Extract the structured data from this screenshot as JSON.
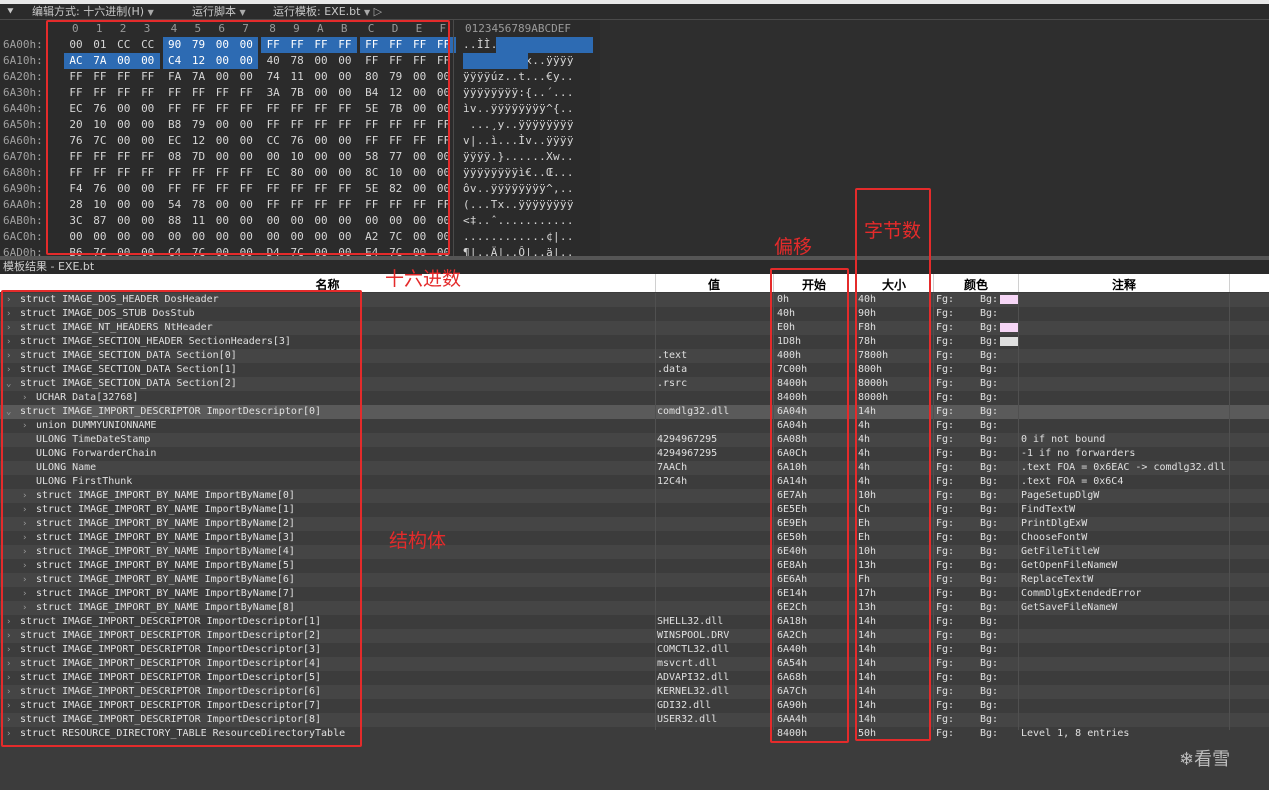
{
  "toolbar": {
    "edit_mode": "编辑方式: 十六进制(H)",
    "run_script": "运行脚本",
    "run_template": "运行模板: EXE.bt"
  },
  "hex": {
    "columns": [
      "0",
      "1",
      "2",
      "3",
      "4",
      "5",
      "6",
      "7",
      "8",
      "9",
      "A",
      "B",
      "C",
      "D",
      "E",
      "F"
    ],
    "ascii_header": "0123456789ABCDEF",
    "rows": [
      {
        "off": "6A00h:",
        "bytes": [
          "00",
          "01",
          "CC",
          "CC",
          "90",
          "79",
          "00",
          "00",
          "FF",
          "FF",
          "FF",
          "FF",
          "FF",
          "FF",
          "FF",
          "FF"
        ],
        "ascii": "..ÌÌ.y..ÿÿÿÿÿÿÿÿ"
      },
      {
        "off": "6A10h:",
        "bytes": [
          "AC",
          "7A",
          "00",
          "00",
          "C4",
          "12",
          "00",
          "00",
          "40",
          "78",
          "00",
          "00",
          "FF",
          "FF",
          "FF",
          "FF"
        ],
        "ascii": "¬z..Ä...@x..ÿÿÿÿ"
      },
      {
        "off": "6A20h:",
        "bytes": [
          "FF",
          "FF",
          "FF",
          "FF",
          "FA",
          "7A",
          "00",
          "00",
          "74",
          "11",
          "00",
          "00",
          "80",
          "79",
          "00",
          "00"
        ],
        "ascii": "ÿÿÿÿúz..t...€y.."
      },
      {
        "off": "6A30h:",
        "bytes": [
          "FF",
          "FF",
          "FF",
          "FF",
          "FF",
          "FF",
          "FF",
          "FF",
          "3A",
          "7B",
          "00",
          "00",
          "B4",
          "12",
          "00",
          "00"
        ],
        "ascii": "ÿÿÿÿÿÿÿÿ:{..´..."
      },
      {
        "off": "6A40h:",
        "bytes": [
          "EC",
          "76",
          "00",
          "00",
          "FF",
          "FF",
          "FF",
          "FF",
          "FF",
          "FF",
          "FF",
          "FF",
          "5E",
          "7B",
          "00",
          "00"
        ],
        "ascii": "ìv..ÿÿÿÿÿÿÿÿ^{.."
      },
      {
        "off": "6A50h:",
        "bytes": [
          "20",
          "10",
          "00",
          "00",
          "B8",
          "79",
          "00",
          "00",
          "FF",
          "FF",
          "FF",
          "FF",
          "FF",
          "FF",
          "FF",
          "FF"
        ],
        "ascii": " ...¸y..ÿÿÿÿÿÿÿÿ"
      },
      {
        "off": "6A60h:",
        "bytes": [
          "76",
          "7C",
          "00",
          "00",
          "EC",
          "12",
          "00",
          "00",
          "CC",
          "76",
          "00",
          "00",
          "FF",
          "FF",
          "FF",
          "FF"
        ],
        "ascii": "v|..ì...Ìv..ÿÿÿÿ"
      },
      {
        "off": "6A70h:",
        "bytes": [
          "FF",
          "FF",
          "FF",
          "FF",
          "08",
          "7D",
          "00",
          "00",
          "00",
          "10",
          "00",
          "00",
          "58",
          "77",
          "00",
          "00"
        ],
        "ascii": "ÿÿÿÿ.}......Xw.."
      },
      {
        "off": "6A80h:",
        "bytes": [
          "FF",
          "FF",
          "FF",
          "FF",
          "FF",
          "FF",
          "FF",
          "FF",
          "EC",
          "80",
          "00",
          "00",
          "8C",
          "10",
          "00",
          "00"
        ],
        "ascii": "ÿÿÿÿÿÿÿÿì€..Œ..."
      },
      {
        "off": "6A90h:",
        "bytes": [
          "F4",
          "76",
          "00",
          "00",
          "FF",
          "FF",
          "FF",
          "FF",
          "FF",
          "FF",
          "FF",
          "FF",
          "5E",
          "82",
          "00",
          "00"
        ],
        "ascii": "ôv..ÿÿÿÿÿÿÿÿ^‚.."
      },
      {
        "off": "6AA0h:",
        "bytes": [
          "28",
          "10",
          "00",
          "00",
          "54",
          "78",
          "00",
          "00",
          "FF",
          "FF",
          "FF",
          "FF",
          "FF",
          "FF",
          "FF",
          "FF"
        ],
        "ascii": "(...Tx..ÿÿÿÿÿÿÿÿ"
      },
      {
        "off": "6AB0h:",
        "bytes": [
          "3C",
          "87",
          "00",
          "00",
          "88",
          "11",
          "00",
          "00",
          "00",
          "00",
          "00",
          "00",
          "00",
          "00",
          "00",
          "00"
        ],
        "ascii": "<‡..ˆ..........."
      },
      {
        "off": "6AC0h:",
        "bytes": [
          "00",
          "00",
          "00",
          "00",
          "00",
          "00",
          "00",
          "00",
          "00",
          "00",
          "00",
          "00",
          "A2",
          "7C",
          "00",
          "00"
        ],
        "ascii": "............¢|.."
      },
      {
        "off": "6AD0h:",
        "bytes": [
          "B6",
          "7C",
          "00",
          "00",
          "C4",
          "7C",
          "00",
          "00",
          "D4",
          "7C",
          "00",
          "00",
          "E4",
          "7C",
          "00",
          "00"
        ],
        "ascii": "¶|..Ä|..Ô|..ä|.."
      }
    ]
  },
  "template_header": "模板结果 - EXE.bt",
  "table": {
    "headers": {
      "name": "名称",
      "value": "值",
      "start": "开始",
      "size": "大小",
      "color": "颜色",
      "note": "注释"
    },
    "rows": [
      {
        "name": "struct IMAGE_DOS_HEADER DosHeader",
        "value": "",
        "start": "0h",
        "size": "40h",
        "note": "",
        "exp": "›",
        "indent": 0,
        "swatch": "#f6d6f6"
      },
      {
        "name": "struct IMAGE_DOS_STUB DosStub",
        "value": "",
        "start": "40h",
        "size": "90h",
        "note": "",
        "exp": "›",
        "indent": 0,
        "swatch": ""
      },
      {
        "name": "struct IMAGE_NT_HEADERS NtHeader",
        "value": "",
        "start": "E0h",
        "size": "F8h",
        "note": "",
        "exp": "›",
        "indent": 0,
        "swatch": "#f6d6f6"
      },
      {
        "name": "struct IMAGE_SECTION_HEADER SectionHeaders[3]",
        "value": "",
        "start": "1D8h",
        "size": "78h",
        "note": "",
        "exp": "›",
        "indent": 0,
        "swatch": "#e0e0e0"
      },
      {
        "name": "struct IMAGE_SECTION_DATA Section[0]",
        "value": ".text",
        "start": "400h",
        "size": "7800h",
        "note": "",
        "exp": "›",
        "indent": 0,
        "swatch": ""
      },
      {
        "name": "struct IMAGE_SECTION_DATA Section[1]",
        "value": ".data",
        "start": "7C00h",
        "size": "800h",
        "note": "",
        "exp": "›",
        "indent": 0,
        "swatch": ""
      },
      {
        "name": "struct IMAGE_SECTION_DATA Section[2]",
        "value": ".rsrc",
        "start": "8400h",
        "size": "8000h",
        "note": "",
        "exp": "⌄",
        "indent": 0,
        "swatch": ""
      },
      {
        "name": "UCHAR Data[32768]",
        "value": "",
        "start": "8400h",
        "size": "8000h",
        "note": "",
        "exp": "›",
        "indent": 1,
        "swatch": ""
      },
      {
        "name": "struct IMAGE_IMPORT_DESCRIPTOR ImportDescriptor[0]",
        "value": "comdlg32.dll",
        "start": "6A04h",
        "size": "14h",
        "note": "",
        "exp": "⌄",
        "indent": 0,
        "swatch": "",
        "hl": true
      },
      {
        "name": "union DUMMYUNIONNAME",
        "value": "",
        "start": "6A04h",
        "size": "4h",
        "note": "",
        "exp": "›",
        "indent": 1,
        "swatch": ""
      },
      {
        "name": "ULONG TimeDateStamp",
        "value": "4294967295",
        "start": "6A08h",
        "size": "4h",
        "note": "0 if not bound",
        "exp": "",
        "indent": 1,
        "swatch": ""
      },
      {
        "name": "ULONG ForwarderChain",
        "value": "4294967295",
        "start": "6A0Ch",
        "size": "4h",
        "note": "-1 if no forwarders",
        "exp": "",
        "indent": 1,
        "swatch": ""
      },
      {
        "name": "ULONG Name",
        "value": "7AACh",
        "start": "6A10h",
        "size": "4h",
        "note": ".text FOA = 0x6EAC -> comdlg32.dll",
        "exp": "",
        "indent": 1,
        "swatch": ""
      },
      {
        "name": "ULONG FirstThunk",
        "value": "12C4h",
        "start": "6A14h",
        "size": "4h",
        "note": ".text FOA = 0x6C4",
        "exp": "",
        "indent": 1,
        "swatch": ""
      },
      {
        "name": "struct IMAGE_IMPORT_BY_NAME ImportByName[0]",
        "value": "",
        "start": "6E7Ah",
        "size": "10h",
        "note": "PageSetupDlgW",
        "exp": "›",
        "indent": 1,
        "swatch": ""
      },
      {
        "name": "struct IMAGE_IMPORT_BY_NAME ImportByName[1]",
        "value": "",
        "start": "6E5Eh",
        "size": "Ch",
        "note": "FindTextW",
        "exp": "›",
        "indent": 1,
        "swatch": ""
      },
      {
        "name": "struct IMAGE_IMPORT_BY_NAME ImportByName[2]",
        "value": "",
        "start": "6E9Eh",
        "size": "Eh",
        "note": "PrintDlgExW",
        "exp": "›",
        "indent": 1,
        "swatch": ""
      },
      {
        "name": "struct IMAGE_IMPORT_BY_NAME ImportByName[3]",
        "value": "",
        "start": "6E50h",
        "size": "Eh",
        "note": "ChooseFontW",
        "exp": "›",
        "indent": 1,
        "swatch": ""
      },
      {
        "name": "struct IMAGE_IMPORT_BY_NAME ImportByName[4]",
        "value": "",
        "start": "6E40h",
        "size": "10h",
        "note": "GetFileTitleW",
        "exp": "›",
        "indent": 1,
        "swatch": ""
      },
      {
        "name": "struct IMAGE_IMPORT_BY_NAME ImportByName[5]",
        "value": "",
        "start": "6E8Ah",
        "size": "13h",
        "note": "GetOpenFileNameW",
        "exp": "›",
        "indent": 1,
        "swatch": ""
      },
      {
        "name": "struct IMAGE_IMPORT_BY_NAME ImportByName[6]",
        "value": "",
        "start": "6E6Ah",
        "size": "Fh",
        "note": "ReplaceTextW",
        "exp": "›",
        "indent": 1,
        "swatch": ""
      },
      {
        "name": "struct IMAGE_IMPORT_BY_NAME ImportByName[7]",
        "value": "",
        "start": "6E14h",
        "size": "17h",
        "note": "CommDlgExtendedError",
        "exp": "›",
        "indent": 1,
        "swatch": ""
      },
      {
        "name": "struct IMAGE_IMPORT_BY_NAME ImportByName[8]",
        "value": "",
        "start": "6E2Ch",
        "size": "13h",
        "note": "GetSaveFileNameW",
        "exp": "›",
        "indent": 1,
        "swatch": ""
      },
      {
        "name": "struct IMAGE_IMPORT_DESCRIPTOR ImportDescriptor[1]",
        "value": "SHELL32.dll",
        "start": "6A18h",
        "size": "14h",
        "note": "",
        "exp": "›",
        "indent": 0,
        "swatch": ""
      },
      {
        "name": "struct IMAGE_IMPORT_DESCRIPTOR ImportDescriptor[2]",
        "value": "WINSPOOL.DRV",
        "start": "6A2Ch",
        "size": "14h",
        "note": "",
        "exp": "›",
        "indent": 0,
        "swatch": ""
      },
      {
        "name": "struct IMAGE_IMPORT_DESCRIPTOR ImportDescriptor[3]",
        "value": "COMCTL32.dll",
        "start": "6A40h",
        "size": "14h",
        "note": "",
        "exp": "›",
        "indent": 0,
        "swatch": ""
      },
      {
        "name": "struct IMAGE_IMPORT_DESCRIPTOR ImportDescriptor[4]",
        "value": "msvcrt.dll",
        "start": "6A54h",
        "size": "14h",
        "note": "",
        "exp": "›",
        "indent": 0,
        "swatch": ""
      },
      {
        "name": "struct IMAGE_IMPORT_DESCRIPTOR ImportDescriptor[5]",
        "value": "ADVAPI32.dll",
        "start": "6A68h",
        "size": "14h",
        "note": "",
        "exp": "›",
        "indent": 0,
        "swatch": ""
      },
      {
        "name": "struct IMAGE_IMPORT_DESCRIPTOR ImportDescriptor[6]",
        "value": "KERNEL32.dll",
        "start": "6A7Ch",
        "size": "14h",
        "note": "",
        "exp": "›",
        "indent": 0,
        "swatch": ""
      },
      {
        "name": "struct IMAGE_IMPORT_DESCRIPTOR ImportDescriptor[7]",
        "value": "GDI32.dll",
        "start": "6A90h",
        "size": "14h",
        "note": "",
        "exp": "›",
        "indent": 0,
        "swatch": ""
      },
      {
        "name": "struct IMAGE_IMPORT_DESCRIPTOR ImportDescriptor[8]",
        "value": "USER32.dll",
        "start": "6AA4h",
        "size": "14h",
        "note": "",
        "exp": "›",
        "indent": 0,
        "swatch": ""
      },
      {
        "name": "struct RESOURCE_DIRECTORY_TABLE ResourceDirectoryTable",
        "value": "",
        "start": "8400h",
        "size": "50h",
        "note": "Level 1, 8 entries",
        "exp": "›",
        "indent": 0,
        "swatch": ""
      }
    ],
    "fg_label": "Fg:",
    "bg_label": "Bg:"
  },
  "annotations": {
    "hex_label": "十六进数",
    "offset_label": "偏移",
    "bytes_label": "字节数",
    "struct_label": "结构体"
  },
  "watermark": "看雪",
  "colors": {
    "selection": "#2d6bb3",
    "annotation": "#e42b2b"
  }
}
